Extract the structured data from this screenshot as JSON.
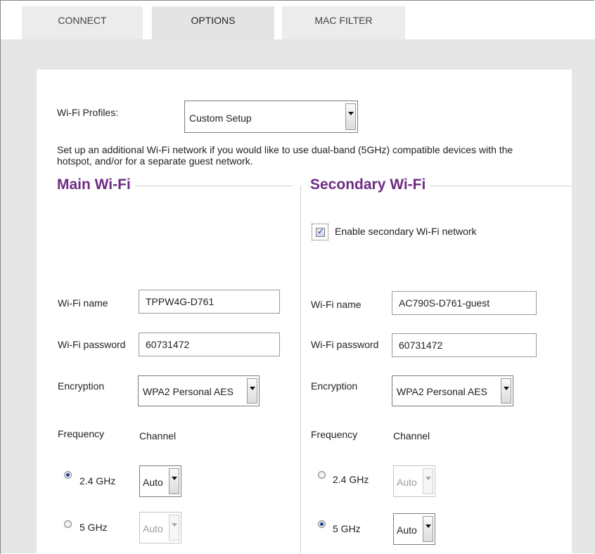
{
  "tabs": [
    {
      "label": "CONNECT",
      "active": false
    },
    {
      "label": "OPTIONS",
      "active": true
    },
    {
      "label": "MAC FILTER",
      "active": false
    }
  ],
  "profiles": {
    "label": "Wi-Fi Profiles:",
    "selected": "Custom Setup"
  },
  "description": "Set up an additional Wi-Fi network if you would like to use dual-band (5GHz) compatible devices with the hotspot, and/or for a separate guest network.",
  "main": {
    "title": "Main Wi-Fi",
    "name_label": "Wi-Fi name",
    "name_value": "TPPW4G-D761",
    "password_label": "Wi-Fi password",
    "password_value": "60731472",
    "encryption_label": "Encryption",
    "encryption_value": "WPA2 Personal AES",
    "frequency_label": "Frequency",
    "channel_label": "Channel",
    "band1_label": "2.4 GHz",
    "band1_channel": "Auto",
    "band2_label": "5 GHz",
    "band2_channel": "Auto",
    "selected_band": "2.4 GHz"
  },
  "secondary": {
    "title": "Secondary Wi-Fi",
    "enable_label": "Enable secondary Wi-Fi network",
    "enabled": true,
    "name_label": "Wi-Fi name",
    "name_value": "AC790S-D761-guest",
    "password_label": "Wi-Fi password",
    "password_value": "60731472",
    "encryption_label": "Encryption",
    "encryption_value": "WPA2 Personal AES",
    "frequency_label": "Frequency",
    "channel_label": "Channel",
    "band1_label": "2.4 GHz",
    "band1_channel": "Auto",
    "band2_label": "5 GHz",
    "band2_channel": "Auto",
    "selected_band": "5 GHz"
  },
  "colors": {
    "accent": "#6e2c83",
    "radio_dot": "#1c3d8f"
  },
  "icons": {
    "dropdown": "chevron-down-icon",
    "check": "checkmark-icon"
  }
}
